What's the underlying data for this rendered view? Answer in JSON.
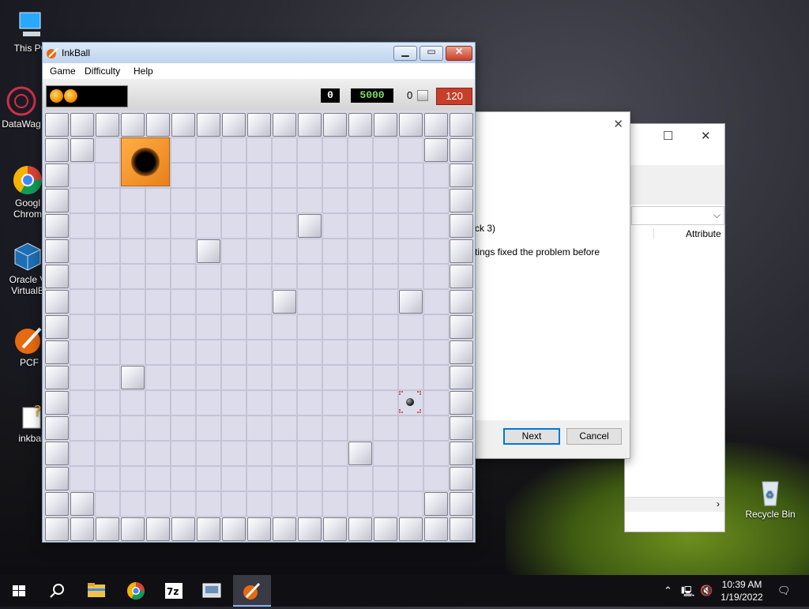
{
  "desktop": {
    "icons": [
      {
        "label_lines": [
          "This PC"
        ],
        "icon": "computer-icon"
      },
      {
        "label_lines": [
          "DataWag"
        ],
        "icon": "datawag-icon"
      },
      {
        "label_lines": [
          "Googl",
          "Chrom"
        ],
        "icon": "chrome-icon"
      },
      {
        "label_lines": [
          "Oracle V",
          "VirtualB"
        ],
        "icon": "virtualbox-icon"
      },
      {
        "label_lines": [
          "PCF"
        ],
        "icon": "pcf-icon"
      },
      {
        "label_lines": [
          "inkbal"
        ],
        "icon": "inkball-shortcut-icon"
      },
      {
        "label_lines": [
          "Recycle Bin"
        ],
        "icon": "recycle-bin-icon"
      }
    ]
  },
  "background_dialog": {
    "text_line1": "ck 3)",
    "text_line2": "tings fixed the problem before",
    "next_label": "Next",
    "cancel_label": "Cancel"
  },
  "background_window": {
    "column_header": "Attribute"
  },
  "inkball": {
    "title": "InkBall",
    "menu": [
      "Game",
      "Difficulty",
      "Help"
    ],
    "score_current": "0",
    "score_target": "5000",
    "captured_count": "0",
    "time_remaining": "120",
    "balls_remaining": 2,
    "colors": {
      "hole": "#f0901e",
      "timer": "#c73e2a",
      "target_score": "#7fdc6a"
    }
  },
  "taskbar": {
    "apps": [
      "start-icon",
      "search-icon",
      "file-explorer-icon",
      "chrome-icon",
      "7zip-icon",
      "control-panel-icon",
      "inkball-icon"
    ],
    "time": "10:39 AM",
    "date": "1/19/2022"
  }
}
